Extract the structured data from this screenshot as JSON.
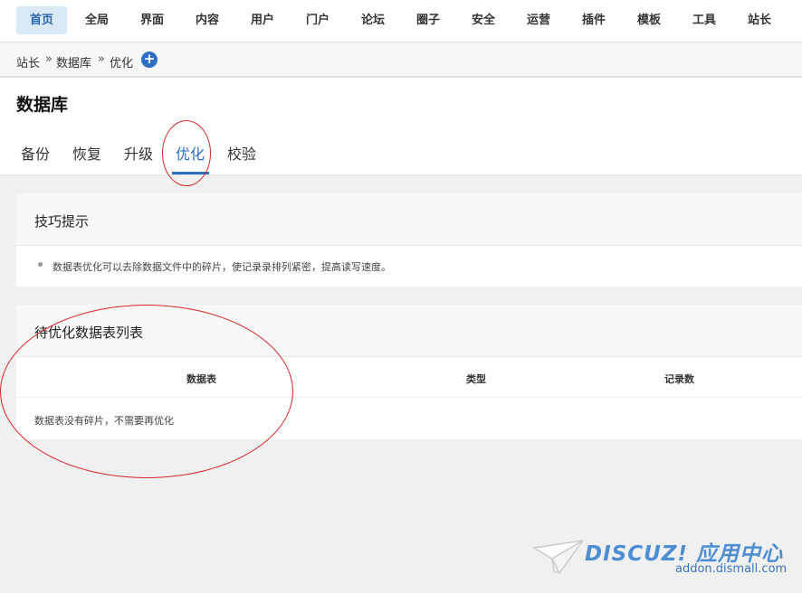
{
  "nav": {
    "items": [
      {
        "label": "首页",
        "active": true
      },
      {
        "label": "全局"
      },
      {
        "label": "界面"
      },
      {
        "label": "内容"
      },
      {
        "label": "用户"
      },
      {
        "label": "门户"
      },
      {
        "label": "论坛"
      },
      {
        "label": "圈子"
      },
      {
        "label": "安全"
      },
      {
        "label": "运营"
      },
      {
        "label": "插件"
      },
      {
        "label": "模板"
      },
      {
        "label": "工具"
      },
      {
        "label": "站长"
      }
    ]
  },
  "breadcrumb": {
    "items": [
      "站长",
      "数据库",
      "优化"
    ],
    "separator": "»",
    "add_icon": "plus-circle-icon"
  },
  "page": {
    "title": "数据库",
    "tabs": [
      {
        "label": "备份"
      },
      {
        "label": "恢复"
      },
      {
        "label": "升级"
      },
      {
        "label": "优化",
        "active": true
      },
      {
        "label": "校验"
      }
    ]
  },
  "tips": {
    "title": "技巧提示",
    "items": [
      "数据表优化可以去除数据文件中的碎片，使记录录排列紧密，提高读写速度。"
    ]
  },
  "table": {
    "title": "待优化数据表列表",
    "columns": [
      "数据表",
      "类型",
      "记录数"
    ],
    "empty_text": "数据表没有碎片，不需要再优化"
  },
  "watermark": {
    "brand": "DISCUZ! 应用中心",
    "site": "addon.dismall.com",
    "icon": "paper-plane-icon"
  },
  "colors": {
    "accent": "#2d6fc4",
    "annotation": "#d9262a",
    "active_nav_bg": "#dbe8f6"
  }
}
